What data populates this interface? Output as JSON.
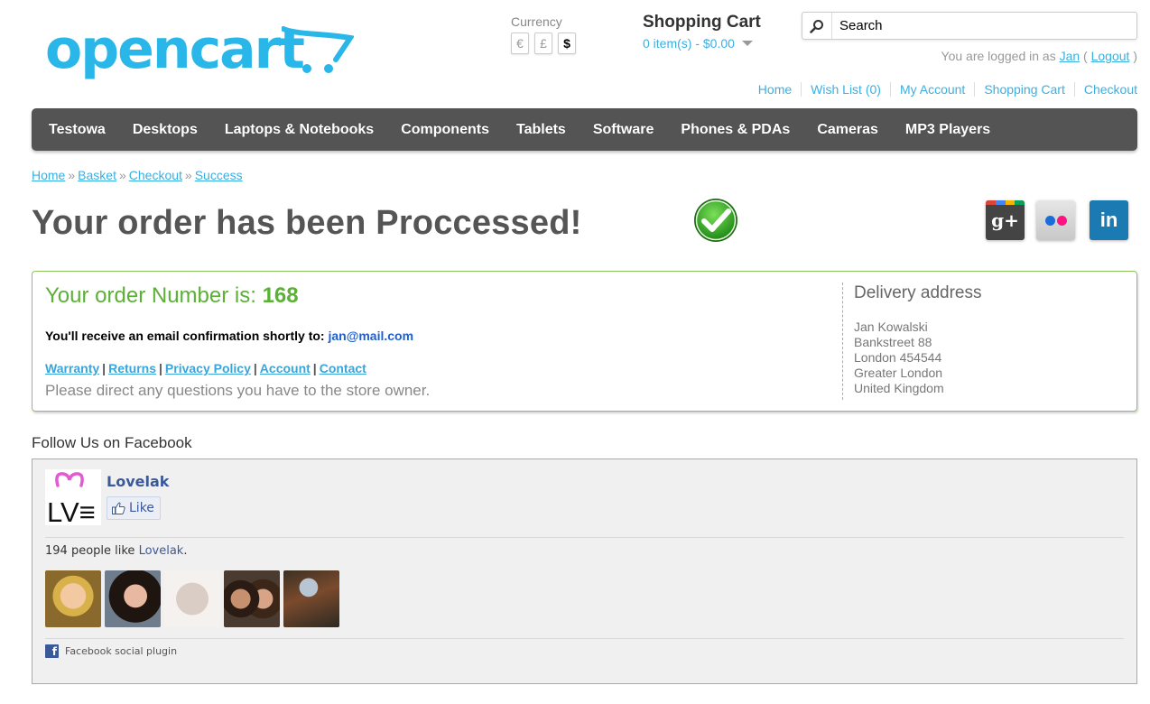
{
  "logo": {
    "text": "opencart"
  },
  "currency": {
    "label": "Currency",
    "options": [
      {
        "symbol": "€",
        "active": false
      },
      {
        "symbol": "£",
        "active": false
      },
      {
        "symbol": "$",
        "active": true
      }
    ]
  },
  "cart": {
    "title": "Shopping Cart",
    "summary": "0 item(s) - $0.00"
  },
  "search": {
    "placeholder": "Search"
  },
  "welcome": {
    "prefix": "You are logged in as ",
    "user": "Jan",
    "open_paren": " ( ",
    "logout": "Logout",
    "close_paren": " )"
  },
  "top_links": [
    "Home",
    "Wish List (0)",
    "My Account",
    "Shopping Cart",
    "Checkout"
  ],
  "menu": [
    "Testowa",
    "Desktops",
    "Laptops & Notebooks",
    "Components",
    "Tablets",
    "Software",
    "Phones & PDAs",
    "Cameras",
    "MP3 Players"
  ],
  "breadcrumb": [
    "Home",
    "Basket",
    "Checkout",
    "Success"
  ],
  "breadcrumb_separator": "»",
  "page_title": "Your order has been Proccessed!",
  "social": {
    "gplus": "g+",
    "linkedin": "in"
  },
  "order": {
    "number_label": "Your order Number is: ",
    "number": "168",
    "email_label": "You'll receive an email confirmation shortly to: ",
    "email": "jan@mail.com",
    "links": [
      "Warranty",
      "Returns",
      "Privacy Policy",
      "Account",
      "Contact"
    ],
    "link_separator": "|",
    "questions": "Please direct any questions you have to the store owner."
  },
  "delivery": {
    "title": "Delivery address",
    "lines": [
      "Jan Kowalski",
      "Bankstreet 88",
      "London 454544",
      "Greater London",
      "United Kingdom"
    ]
  },
  "facebook": {
    "heading": "Follow Us on Facebook",
    "page_name": "Lovelak",
    "like_label": "Like",
    "count_text": "194 people like ",
    "count_link": "Lovelak",
    "count_suffix": ".",
    "plugin_label": "Facebook social plugin",
    "logo_letters": "LV≡",
    "brand_color": "#3b5998"
  }
}
